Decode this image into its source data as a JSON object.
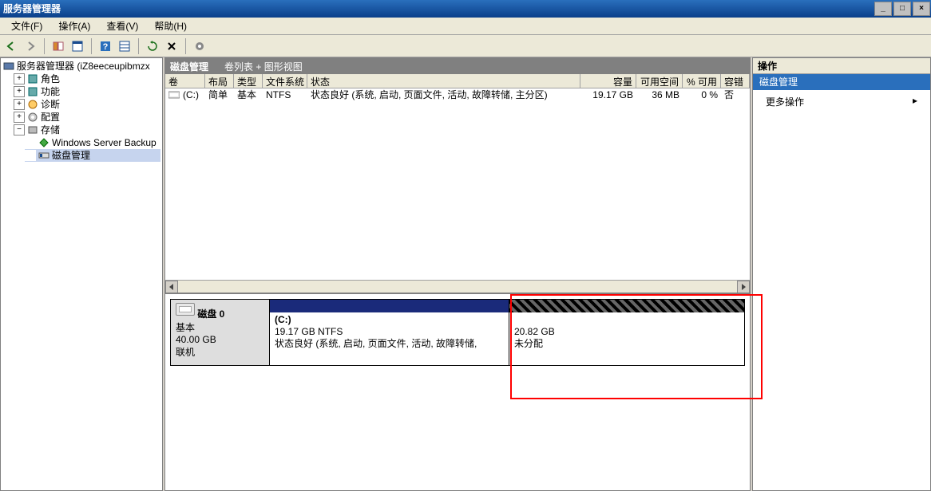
{
  "window": {
    "title": "服务器管理器"
  },
  "menubar": {
    "file": "文件(F)",
    "action": "操作(A)",
    "view": "查看(V)",
    "help": "帮助(H)"
  },
  "toolbar": {
    "back_icon": "back-arrow-icon",
    "forward_icon": "forward-arrow-icon",
    "up_icon": "up-icon",
    "props_icon": "properties-icon",
    "help_icon": "help-icon",
    "view_icon": "view-icon",
    "refresh_icon": "refresh-icon",
    "delete_icon": "delete-icon",
    "list_icon": "list-icon"
  },
  "tree": {
    "root": "服务器管理器 (iZ8eeceupibmzx",
    "roles": "角色",
    "features": "功能",
    "diagnostics": "诊断",
    "configuration": "配置",
    "storage": "存储",
    "wsb": "Windows Server Backup",
    "diskmgmt": "磁盘管理"
  },
  "center": {
    "title": "磁盘管理",
    "subtitle": "卷列表 + 图形视图"
  },
  "columns": {
    "volume": "卷",
    "layout": "布局",
    "type": "类型",
    "filesystem": "文件系统",
    "status": "状态",
    "capacity": "容量",
    "freespace": "可用空间",
    "pctfree": "% 可用",
    "faulttol": "容错"
  },
  "volumes": [
    {
      "name": "(C:)",
      "layout": "简单",
      "type": "基本",
      "fs": "NTFS",
      "status": "状态良好 (系统, 启动, 页面文件, 活动, 故障转储, 主分区)",
      "capacity": "19.17 GB",
      "free": "36 MB",
      "pct": "0 %",
      "fault": "否"
    }
  ],
  "disk0": {
    "name": "磁盘 0",
    "basic": "基本",
    "size": "40.00 GB",
    "online": "联机"
  },
  "partC": {
    "drive": "(C:)",
    "size_fs": "19.17 GB NTFS",
    "status": "状态良好 (系统, 启动, 页面文件, 活动, 故障转储,"
  },
  "unalloc": {
    "size": "20.82 GB",
    "label": "未分配"
  },
  "actions": {
    "header": "操作",
    "section": "磁盘管理",
    "more": "更多操作"
  }
}
